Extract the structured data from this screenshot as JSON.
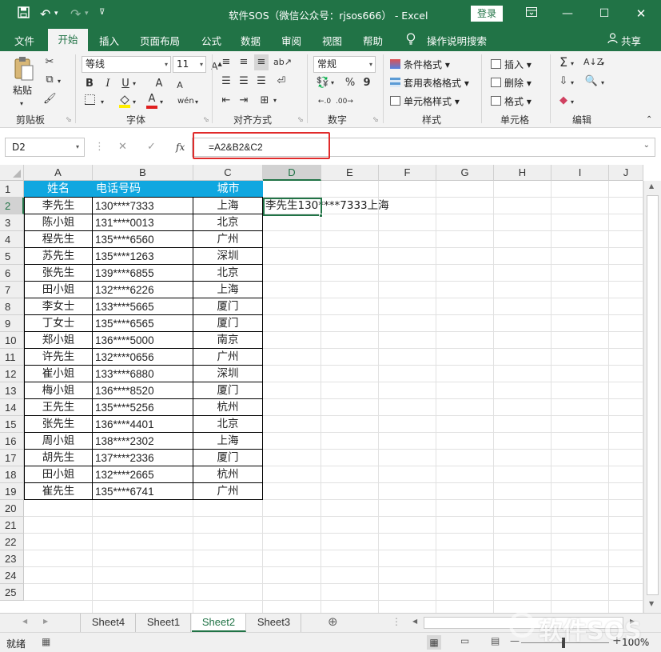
{
  "window": {
    "title": "软件SOS（微信公众号：rjsos666） - Excel",
    "login": "登录"
  },
  "tabs": [
    "文件",
    "开始",
    "插入",
    "页面布局",
    "公式",
    "数据",
    "审阅",
    "视图",
    "帮助"
  ],
  "tell_me": "操作说明搜索",
  "share": "共享",
  "ribbon": {
    "clipboard": {
      "label": "剪贴板",
      "paste": "粘贴"
    },
    "font": {
      "label": "字体",
      "name": "等线",
      "size": "11",
      "bold": "B",
      "italic": "I",
      "underline": "U",
      "grow": "A",
      "shrink": "A",
      "color_letter": "A"
    },
    "alignment": {
      "label": "对齐方式"
    },
    "number": {
      "label": "数字",
      "format": "常规",
      "percent": "%",
      "comma": "9"
    },
    "styles": {
      "label": "样式",
      "conditional": "条件格式",
      "table": "套用表格格式",
      "cell": "单元格样式"
    },
    "cells": {
      "label": "单元格",
      "insert": "插入",
      "delete": "删除",
      "format": "格式"
    },
    "editing": {
      "label": "编辑"
    }
  },
  "formula_bar": {
    "name_box": "D2",
    "fx": "fx",
    "formula": "=A2&B2&C2"
  },
  "columns": [
    "A",
    "B",
    "C",
    "D",
    "E",
    "F",
    "G",
    "H",
    "I",
    "J"
  ],
  "row_numbers": [
    "1",
    "2",
    "3",
    "4",
    "5",
    "6",
    "7",
    "8",
    "9",
    "10",
    "11",
    "12",
    "13",
    "14",
    "15",
    "16",
    "17",
    "18",
    "19",
    "20",
    "21",
    "22",
    "23",
    "24",
    "25"
  ],
  "table": {
    "headers": [
      "姓名",
      "电话号码",
      "城市"
    ],
    "rows": [
      [
        "李先生",
        "130****7333",
        "上海"
      ],
      [
        "陈小姐",
        "131****0013",
        "北京"
      ],
      [
        "程先生",
        "135****6560",
        "广州"
      ],
      [
        "苏先生",
        "135****1263",
        "深圳"
      ],
      [
        "张先生",
        "139****6855",
        "北京"
      ],
      [
        "田小姐",
        "132****6226",
        "上海"
      ],
      [
        "李女士",
        "133****5665",
        "厦门"
      ],
      [
        "丁女士",
        "135****6565",
        "厦门"
      ],
      [
        "郑小姐",
        "136****5000",
        "南京"
      ],
      [
        "许先生",
        "132****0656",
        "广州"
      ],
      [
        "崔小姐",
        "133****6880",
        "深圳"
      ],
      [
        "梅小姐",
        "136****8520",
        "厦门"
      ],
      [
        "王先生",
        "135****5256",
        "杭州"
      ],
      [
        "张先生",
        "136****4401",
        "北京"
      ],
      [
        "周小姐",
        "138****2302",
        "上海"
      ],
      [
        "胡先生",
        "137****2336",
        "厦门"
      ],
      [
        "田小姐",
        "132****2665",
        "杭州"
      ],
      [
        "崔先生",
        "135****6741",
        "广州"
      ]
    ]
  },
  "d2_value": "李先生130****7333上海",
  "sheets": [
    "Sheet4",
    "Sheet1",
    "Sheet2",
    "Sheet3"
  ],
  "active_sheet": "Sheet2",
  "status": {
    "ready": "就绪",
    "zoom": "100%"
  },
  "watermark": "软件SOS",
  "colors": {
    "excel_green": "#217346",
    "header_fill": "#10a7e0",
    "highlight": "#e02b2b"
  }
}
